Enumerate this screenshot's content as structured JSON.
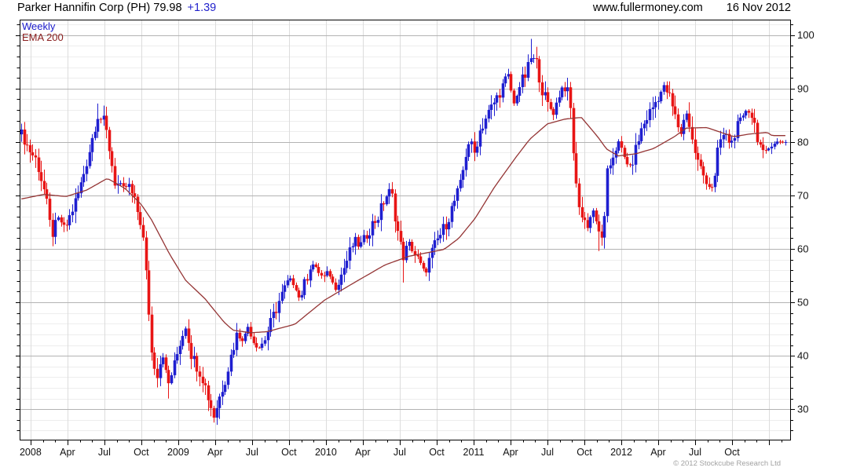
{
  "header": {
    "title": "Parker Hannifin Corp (PH) 79.98",
    "change": "+1.39",
    "site": "www.fullermoney.com",
    "date": "16 Nov 2012"
  },
  "legend": {
    "timeframe": "Weekly",
    "overlay": "EMA 200"
  },
  "footer": {
    "copyright": "© 2012 Stockcube Research Ltd"
  },
  "colors": {
    "up": "#1f1fd0",
    "down": "#e81515",
    "ema": "#943434",
    "grid_major": "#b3b3b3",
    "grid_minor": "#ededed",
    "grid_vertical": "#dcdcdc",
    "axis": "#000000",
    "label": "#111111"
  },
  "chart_data": {
    "type": "candlestick",
    "title": "Parker Hannifin Corp (PH) weekly candlesticks with EMA 200",
    "timeframe": "Weekly",
    "overlay": "EMA 200",
    "x_axis": {
      "start": 2007.926,
      "end": 2013.149,
      "minor_tick_months": 1,
      "major_ticks": [
        {
          "t": 2008.0,
          "label": "2008"
        },
        {
          "t": 2008.25,
          "label": "Apr"
        },
        {
          "t": 2008.5,
          "label": "Jul"
        },
        {
          "t": 2008.75,
          "label": "Oct"
        },
        {
          "t": 2009.0,
          "label": "2009"
        },
        {
          "t": 2009.25,
          "label": "Apr"
        },
        {
          "t": 2009.5,
          "label": "Jul"
        },
        {
          "t": 2009.75,
          "label": "Oct"
        },
        {
          "t": 2010.0,
          "label": "2010"
        },
        {
          "t": 2010.25,
          "label": "Apr"
        },
        {
          "t": 2010.5,
          "label": "Jul"
        },
        {
          "t": 2010.75,
          "label": "Oct"
        },
        {
          "t": 2011.0,
          "label": "2011"
        },
        {
          "t": 2011.25,
          "label": "Apr"
        },
        {
          "t": 2011.5,
          "label": "Jul"
        },
        {
          "t": 2011.75,
          "label": "Oct"
        },
        {
          "t": 2012.0,
          "label": "2012"
        },
        {
          "t": 2012.25,
          "label": "Apr"
        },
        {
          "t": 2012.5,
          "label": "Jul"
        },
        {
          "t": 2012.75,
          "label": "Oct"
        }
      ]
    },
    "y_axis": {
      "min": 24.3,
      "max": 102.9,
      "minor_step": 2,
      "major_ticks": [
        30,
        40,
        50,
        60,
        70,
        80,
        90,
        100
      ]
    },
    "series": {
      "close_anchors": [
        [
          2007.93,
          82
        ],
        [
          2007.98,
          79
        ],
        [
          2008.04,
          76.5
        ],
        [
          2008.1,
          70
        ],
        [
          2008.14,
          62.5
        ],
        [
          2008.19,
          66
        ],
        [
          2008.23,
          63.5
        ],
        [
          2008.27,
          66.5
        ],
        [
          2008.33,
          71
        ],
        [
          2008.37,
          75.5
        ],
        [
          2008.41,
          80
        ],
        [
          2008.45,
          85
        ],
        [
          2008.5,
          83.5
        ],
        [
          2008.53,
          79
        ],
        [
          2008.57,
          72.5
        ],
        [
          2008.62,
          71
        ],
        [
          2008.66,
          72
        ],
        [
          2008.7,
          69
        ],
        [
          2008.74,
          65.5
        ],
        [
          2008.76,
          62
        ],
        [
          2008.79,
          52
        ],
        [
          2008.82,
          40
        ],
        [
          2008.86,
          36.5
        ],
        [
          2008.89,
          41
        ],
        [
          2008.93,
          34.5
        ],
        [
          2008.97,
          38
        ],
        [
          2009.01,
          42.5
        ],
        [
          2009.05,
          45.5
        ],
        [
          2009.09,
          40
        ],
        [
          2009.13,
          38
        ],
        [
          2009.17,
          35.5
        ],
        [
          2009.21,
          31.5
        ],
        [
          2009.24,
          28.5
        ],
        [
          2009.28,
          32.5
        ],
        [
          2009.32,
          36
        ],
        [
          2009.36,
          40.5
        ],
        [
          2009.4,
          44.5
        ],
        [
          2009.44,
          43
        ],
        [
          2009.47,
          45.5
        ],
        [
          2009.51,
          42.5
        ],
        [
          2009.55,
          41.5
        ],
        [
          2009.59,
          43.5
        ],
        [
          2009.63,
          46.5
        ],
        [
          2009.67,
          49.5
        ],
        [
          2009.71,
          52
        ],
        [
          2009.75,
          54.5
        ],
        [
          2009.79,
          53
        ],
        [
          2009.82,
          50.5
        ],
        [
          2009.86,
          54
        ],
        [
          2009.9,
          57.5
        ],
        [
          2009.94,
          56
        ],
        [
          2009.98,
          54.5
        ],
        [
          2010.02,
          55.5
        ],
        [
          2010.06,
          52.5
        ],
        [
          2010.1,
          55
        ],
        [
          2010.15,
          58.5
        ],
        [
          2010.19,
          61.5
        ],
        [
          2010.23,
          60.5
        ],
        [
          2010.27,
          62.5
        ],
        [
          2010.31,
          64.5
        ],
        [
          2010.35,
          66
        ],
        [
          2010.4,
          69.5
        ],
        [
          2010.44,
          71
        ],
        [
          2010.48,
          64
        ],
        [
          2010.52,
          58.5
        ],
        [
          2010.56,
          61
        ],
        [
          2010.6,
          59
        ],
        [
          2010.64,
          57
        ],
        [
          2010.67,
          55.5
        ],
        [
          2010.71,
          59
        ],
        [
          2010.75,
          61.5
        ],
        [
          2010.79,
          63.5
        ],
        [
          2010.83,
          66
        ],
        [
          2010.87,
          69
        ],
        [
          2010.91,
          72
        ],
        [
          2010.95,
          78.5
        ],
        [
          2010.97,
          80.5
        ],
        [
          2011.0,
          77.5
        ],
        [
          2011.04,
          82
        ],
        [
          2011.08,
          84.5
        ],
        [
          2011.12,
          86.5
        ],
        [
          2011.16,
          88.5
        ],
        [
          2011.2,
          91
        ],
        [
          2011.23,
          93
        ],
        [
          2011.27,
          87
        ],
        [
          2011.31,
          90.5
        ],
        [
          2011.35,
          92.5
        ],
        [
          2011.39,
          96
        ],
        [
          2011.43,
          94.5
        ],
        [
          2011.46,
          90
        ],
        [
          2011.5,
          87
        ],
        [
          2011.54,
          85.5
        ],
        [
          2011.58,
          89
        ],
        [
          2011.61,
          91
        ],
        [
          2011.65,
          88
        ],
        [
          2011.69,
          72
        ],
        [
          2011.73,
          66
        ],
        [
          2011.77,
          64.5
        ],
        [
          2011.81,
          67.5
        ],
        [
          2011.84,
          63
        ],
        [
          2011.88,
          62.5
        ],
        [
          2011.9,
          73.5
        ],
        [
          2011.94,
          77.5
        ],
        [
          2011.98,
          80
        ],
        [
          2012.02,
          77
        ],
        [
          2012.06,
          75
        ],
        [
          2012.1,
          79
        ],
        [
          2012.13,
          82
        ],
        [
          2012.17,
          84.5
        ],
        [
          2012.21,
          86.5
        ],
        [
          2012.25,
          88.5
        ],
        [
          2012.29,
          90.5
        ],
        [
          2012.33,
          88
        ],
        [
          2012.37,
          84
        ],
        [
          2012.4,
          81.5
        ],
        [
          2012.44,
          86
        ],
        [
          2012.48,
          80
        ],
        [
          2012.52,
          76
        ],
        [
          2012.56,
          73.5
        ],
        [
          2012.6,
          71.5
        ],
        [
          2012.63,
          72.5
        ],
        [
          2012.66,
          80
        ],
        [
          2012.7,
          81.5
        ],
        [
          2012.74,
          79.5
        ],
        [
          2012.78,
          82.5
        ],
        [
          2012.82,
          84
        ],
        [
          2012.85,
          86.5
        ],
        [
          2012.89,
          84.5
        ],
        [
          2012.93,
          80
        ],
        [
          2012.96,
          77.5
        ],
        [
          2012.99,
          78.5
        ],
        [
          2013.02,
          79.98
        ]
      ],
      "ema_anchors": [
        [
          2007.93,
          69.3
        ],
        [
          2008.09,
          70.2
        ],
        [
          2008.24,
          69.8
        ],
        [
          2008.38,
          71
        ],
        [
          2008.52,
          73.2
        ],
        [
          2008.64,
          71.3
        ],
        [
          2008.75,
          68.3
        ],
        [
          2008.82,
          65.4
        ],
        [
          2008.94,
          59.1
        ],
        [
          2009.05,
          54.1
        ],
        [
          2009.18,
          50.7
        ],
        [
          2009.31,
          46.3
        ],
        [
          2009.37,
          44.8
        ],
        [
          2009.49,
          44.3
        ],
        [
          2009.6,
          44.5
        ],
        [
          2009.79,
          45.9
        ],
        [
          2009.99,
          50.4
        ],
        [
          2010.23,
          54.3
        ],
        [
          2010.4,
          57
        ],
        [
          2010.56,
          58.6
        ],
        [
          2010.8,
          59.9
        ],
        [
          2010.9,
          62
        ],
        [
          2011.01,
          65.7
        ],
        [
          2011.14,
          71.5
        ],
        [
          2011.28,
          76.9
        ],
        [
          2011.38,
          80.5
        ],
        [
          2011.5,
          83.4
        ],
        [
          2011.62,
          84.3
        ],
        [
          2011.73,
          84.6
        ],
        [
          2011.84,
          81
        ],
        [
          2011.9,
          78.7
        ],
        [
          2011.98,
          77.4
        ],
        [
          2012.1,
          77.8
        ],
        [
          2012.22,
          78.8
        ],
        [
          2012.36,
          81
        ],
        [
          2012.44,
          82.6
        ],
        [
          2012.58,
          82.7
        ],
        [
          2012.76,
          81
        ],
        [
          2012.87,
          81.5
        ],
        [
          2012.99,
          81.8
        ],
        [
          2013.02,
          81.2
        ]
      ],
      "wick_extremes": [
        {
          "t": 2008.45,
          "high": 87.2
        },
        {
          "t": 2008.93,
          "low": 32
        },
        {
          "t": 2009.24,
          "low": 27.5
        },
        {
          "t": 2010.44,
          "high": 72.5
        },
        {
          "t": 2010.52,
          "low": 53.7
        },
        {
          "t": 2011.23,
          "high": 93.7
        },
        {
          "t": 2011.39,
          "high": 99.3
        },
        {
          "t": 2011.84,
          "low": 59.6
        },
        {
          "t": 2012.63,
          "low": 70.6
        }
      ],
      "last_close": 79.98
    }
  }
}
